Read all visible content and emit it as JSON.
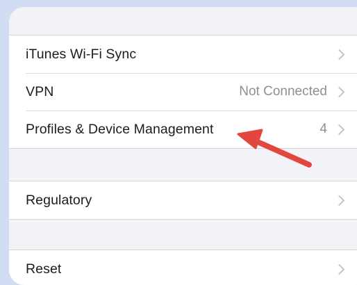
{
  "group1": {
    "items": [
      {
        "label": "iTunes Wi-Fi Sync",
        "value": ""
      },
      {
        "label": "VPN",
        "value": "Not Connected"
      },
      {
        "label": "Profiles & Device Management",
        "value": "4"
      }
    ]
  },
  "group2": {
    "items": [
      {
        "label": "Regulatory",
        "value": ""
      }
    ]
  },
  "group3": {
    "items": [
      {
        "label": "Reset",
        "value": ""
      }
    ]
  },
  "colors": {
    "background": "#d2dcf3",
    "annotation_arrow": "#e2463f"
  },
  "icons": {
    "chevron": "chevron-right-icon",
    "annotation": "red-arrow-annotation"
  }
}
